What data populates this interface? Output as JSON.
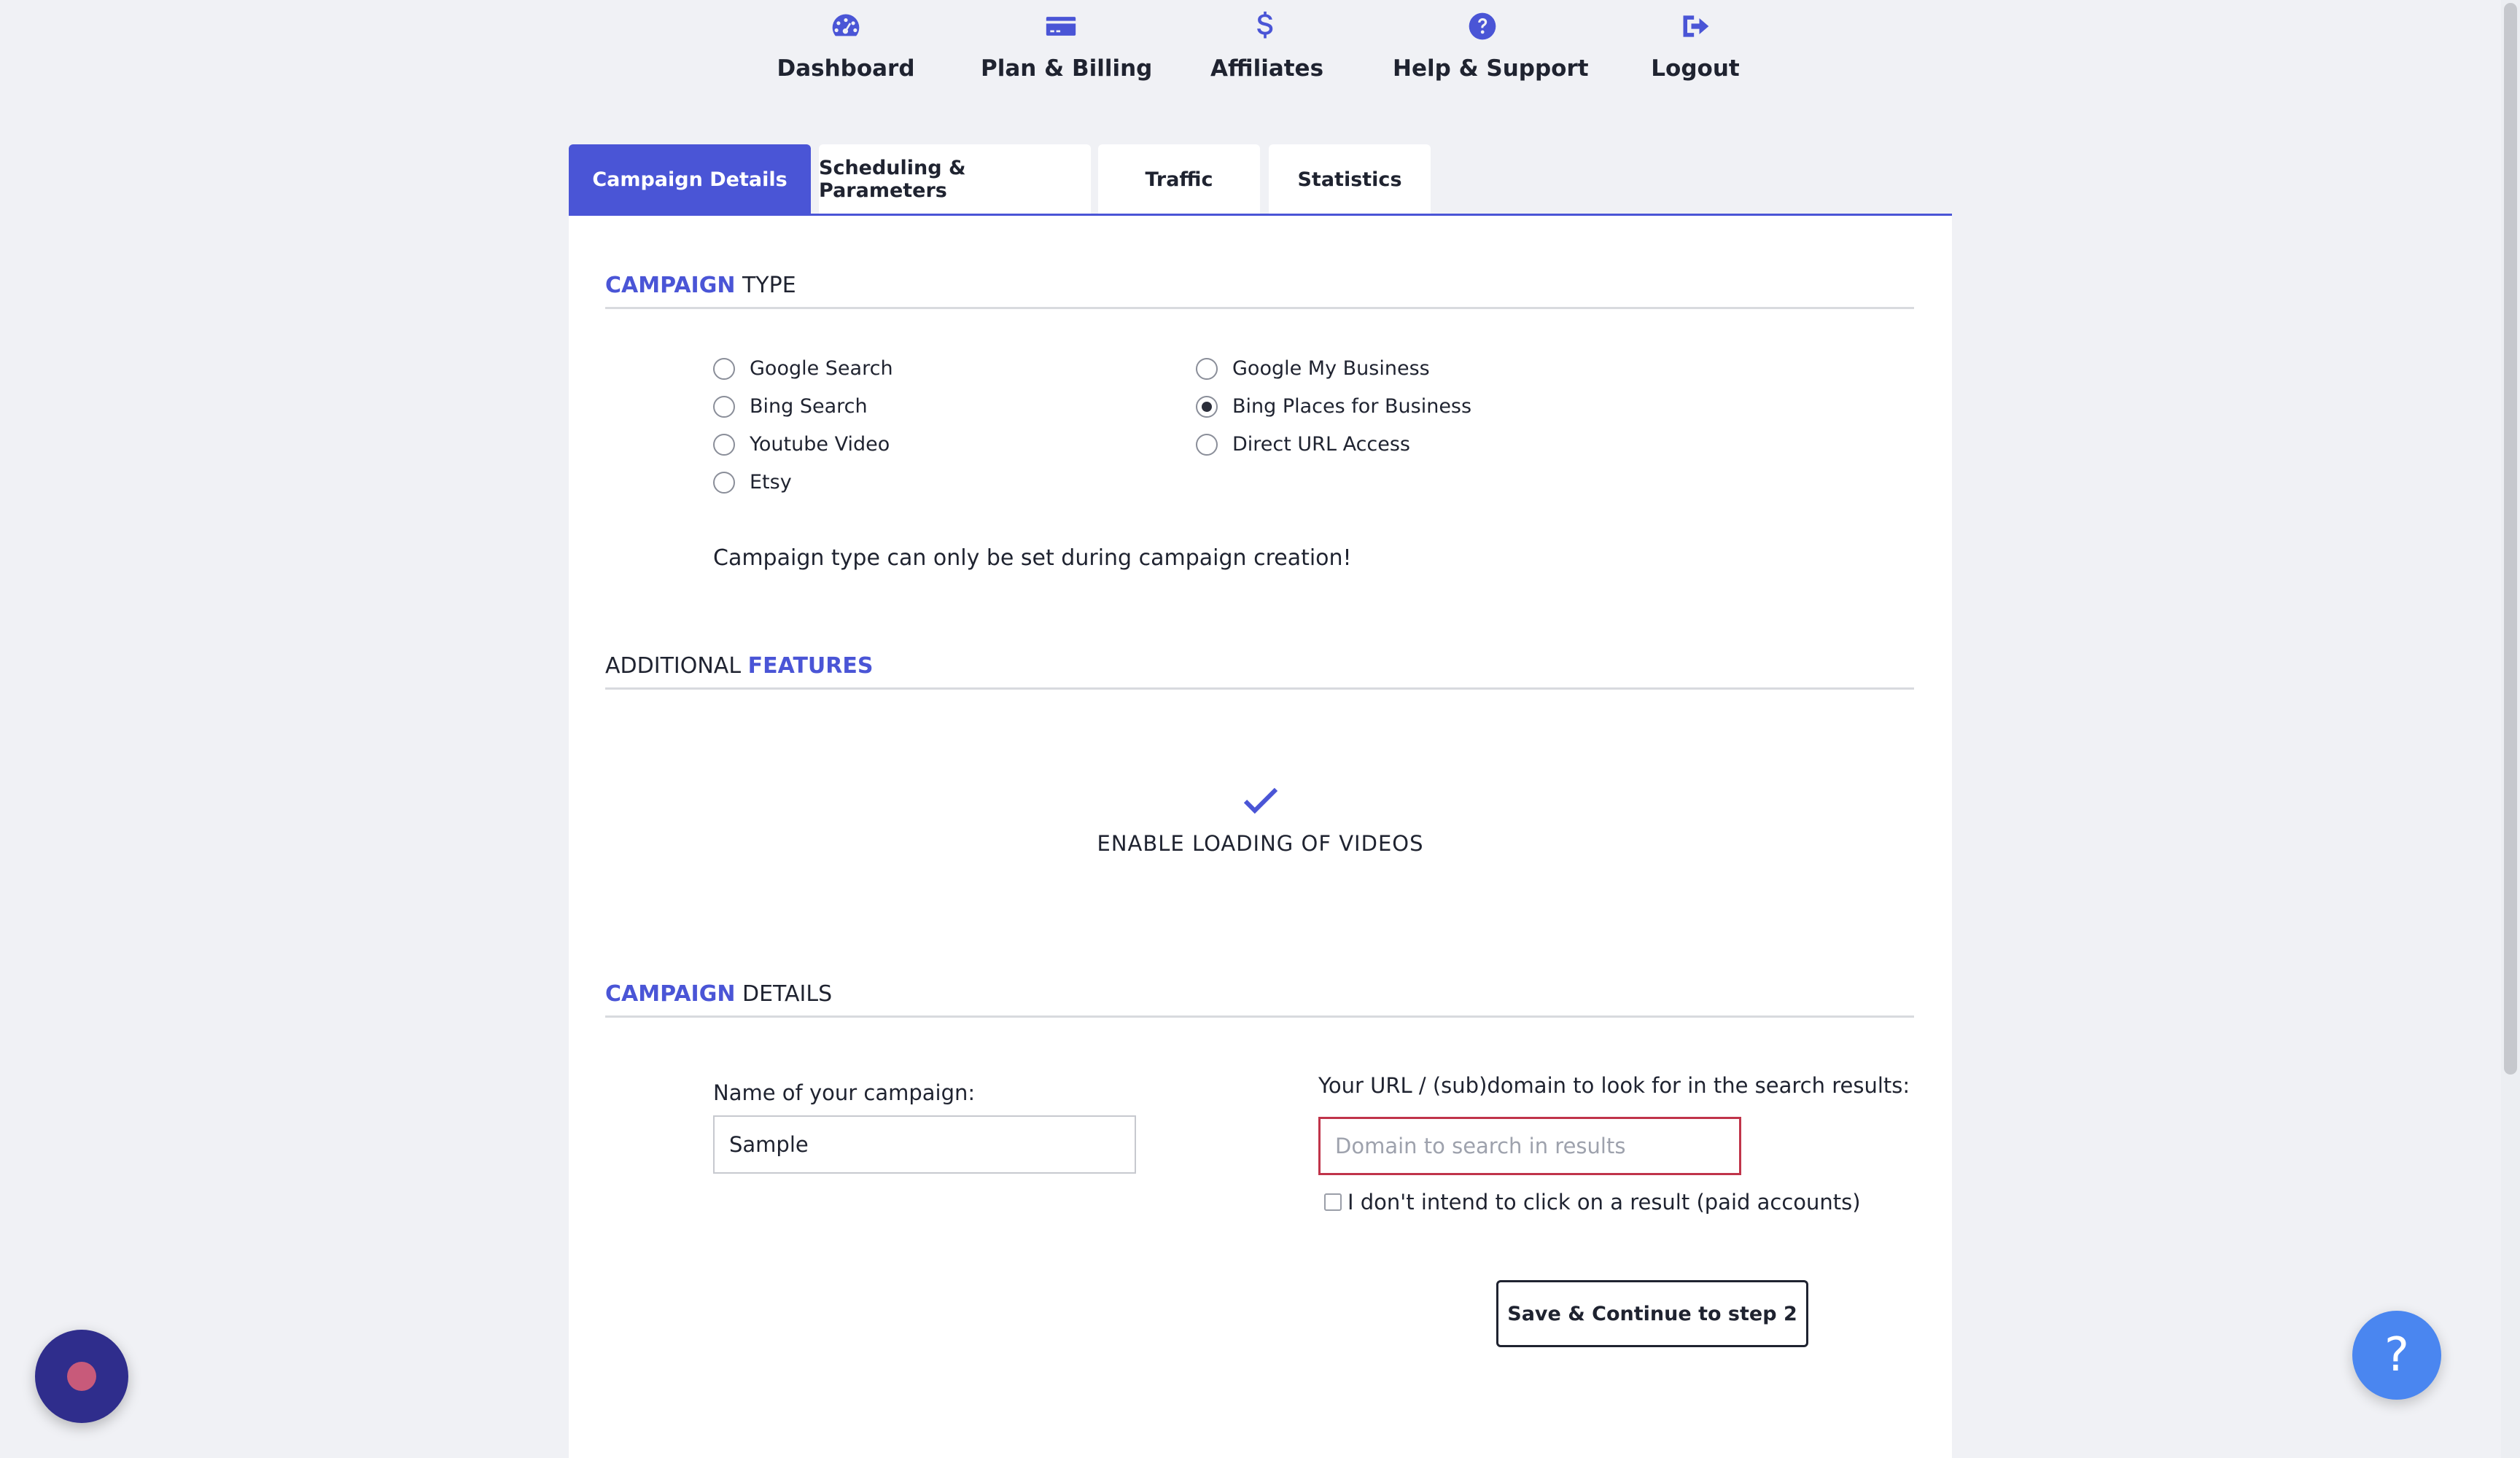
{
  "nav": {
    "items": [
      {
        "label": "Dashboard",
        "icon": "dashboard-gauge-icon"
      },
      {
        "label": "Plan & Billing",
        "icon": "credit-card-icon"
      },
      {
        "label": "Affiliates",
        "icon": "dollar-icon"
      },
      {
        "label": "Help & Support",
        "icon": "question-circle-icon"
      },
      {
        "label": "Logout",
        "icon": "logout-icon"
      }
    ]
  },
  "tabs": [
    {
      "label": "Campaign Details",
      "active": true
    },
    {
      "label": "Scheduling & Parameters",
      "active": false
    },
    {
      "label": "Traffic",
      "active": false
    },
    {
      "label": "Statistics",
      "active": false
    }
  ],
  "campaign_type": {
    "heading_accent": "CAMPAIGN",
    "heading_rest": "TYPE",
    "options": [
      {
        "label": "Google Search",
        "checked": false
      },
      {
        "label": "Bing Search",
        "checked": false
      },
      {
        "label": "Youtube Video",
        "checked": false
      },
      {
        "label": "Etsy",
        "checked": false
      },
      {
        "label": "Google My Business",
        "checked": false
      },
      {
        "label": "Bing Places for Business",
        "checked": true
      },
      {
        "label": "Direct URL Access",
        "checked": false
      }
    ],
    "note": "Campaign type can only be set during campaign creation!"
  },
  "additional_features": {
    "heading_rest": "ADDITIONAL",
    "heading_accent": "FEATURES",
    "feature_label": "ENABLE LOADING OF VIDEOS",
    "feature_enabled": true
  },
  "campaign_details": {
    "heading_accent": "CAMPAIGN",
    "heading_rest": "DETAILS",
    "name_label": "Name of your campaign:",
    "name_value": "Sample",
    "url_label": "Your URL / (sub)domain to look for in the search results:",
    "url_value": "",
    "url_placeholder": "Domain to search in results",
    "no_click_label": "I don't intend to click on a result (paid accounts)",
    "no_click_checked": false,
    "save_label": "Save & Continue to step 2"
  },
  "help_fab": {
    "label": "?"
  },
  "colors": {
    "accent": "#4a55d6",
    "error": "#c0344a",
    "fab": "#4a86f0",
    "chat": "#2f2d8c"
  }
}
